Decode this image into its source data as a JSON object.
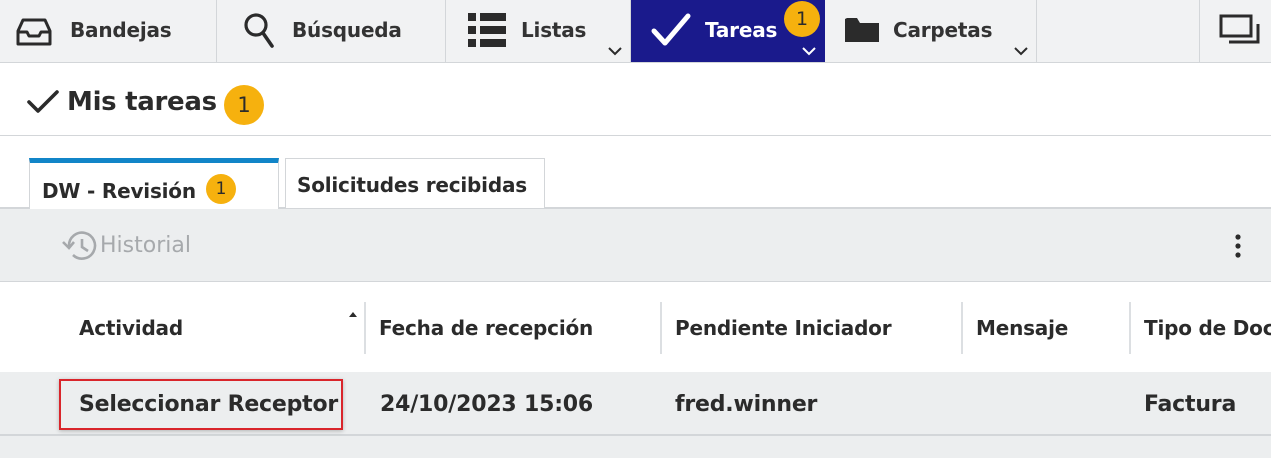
{
  "nav": {
    "items": [
      {
        "label": "Bandejas",
        "icon": "inbox-icon"
      },
      {
        "label": "Búsqueda",
        "icon": "search-icon"
      },
      {
        "label": "Listas",
        "icon": "list-icon"
      },
      {
        "label": "Tareas",
        "icon": "checkmark-icon",
        "badge": "1",
        "active": true
      },
      {
        "label": "Carpetas",
        "icon": "folder-icon"
      }
    ],
    "window_icon": "window-restore-icon"
  },
  "header": {
    "title": "Mis tareas",
    "badge": "1"
  },
  "tabs": [
    {
      "label": "DW - Revisión",
      "badge": "1",
      "active": true
    },
    {
      "label": "Solicitudes recibidas",
      "active": false
    }
  ],
  "toolbar": {
    "history_label": "Historial",
    "menu_icon": "more-vertical-icon"
  },
  "table": {
    "columns": [
      "Actividad",
      "Fecha de recepción",
      "Pendiente Iniciador",
      "Mensaje",
      "Tipo de Doc"
    ],
    "rows": [
      {
        "actividad": "Seleccionar Receptor",
        "fecha": "24/10/2023 15:06",
        "pendiente": "fred.winner",
        "mensaje": "",
        "tipo": "Factura"
      }
    ]
  },
  "colors": {
    "active_nav": "#1a1a8c",
    "badge": "#f6b10e",
    "tab_accent": "#1185c8",
    "selection": "#d9252b"
  }
}
